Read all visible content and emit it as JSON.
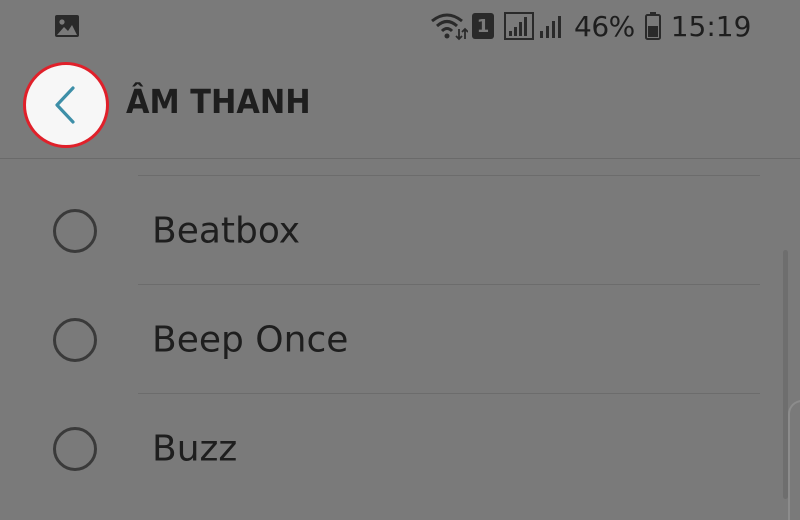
{
  "status_bar": {
    "gallery_icon": "image-icon",
    "sim_slot": "1",
    "battery_percent": "46%",
    "time": "15:19"
  },
  "header": {
    "back_icon": "chevron-left-icon",
    "title": "ÂM THANH"
  },
  "sound_list": {
    "items": [
      {
        "label": "Beatbox",
        "selected": false
      },
      {
        "label": "Beep Once",
        "selected": false
      },
      {
        "label": "Buzz",
        "selected": false
      }
    ]
  },
  "colors": {
    "overlay_background": "#7a7a7a",
    "back_button_fill": "#f7f7f7",
    "back_button_highlight": "#e0202a",
    "chevron": "#3e8fa8",
    "text": "#1e1e1e"
  }
}
